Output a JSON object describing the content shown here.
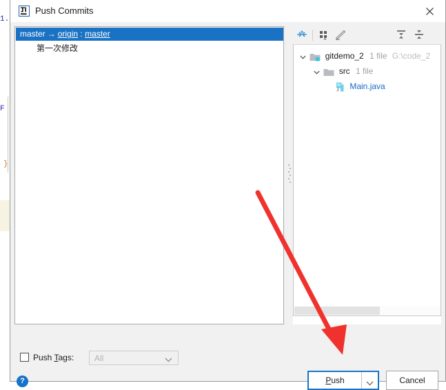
{
  "window": {
    "title": "Push Commits",
    "app_icon": "intellij-idea-icon",
    "close_icon": "close-icon"
  },
  "commits": {
    "group_row": {
      "local_branch": "master",
      "arrow": "→",
      "remote": "origin",
      "separator": ":",
      "remote_branch": "master",
      "selected": true
    },
    "entries": [
      {
        "message": "第一次修改"
      }
    ]
  },
  "files_toolbar": {
    "buttons": [
      {
        "name": "expand-selection-icon",
        "title": ""
      },
      {
        "name": "group-by-icon",
        "title": ""
      },
      {
        "name": "edit-source-icon",
        "title": ""
      },
      {
        "name": "expand-all-icon",
        "title": ""
      },
      {
        "name": "collapse-all-icon",
        "title": ""
      }
    ]
  },
  "file_tree": [
    {
      "name": "gitdemo_2",
      "meta": "1 file",
      "path": "G:\\code_2",
      "icon": "module-folder-icon",
      "expanded": true,
      "depth": 0
    },
    {
      "name": "src",
      "meta": "1 file",
      "path": "",
      "icon": "folder-icon",
      "expanded": true,
      "depth": 1
    },
    {
      "name": "Main.java",
      "meta": "",
      "path": "",
      "icon": "java-class-icon",
      "expanded": null,
      "depth": 2
    }
  ],
  "push_tags": {
    "label_pre": "Push ",
    "label_mnemonic": "T",
    "label_post": "ags:",
    "checked": false,
    "combo_value": "All",
    "combo_enabled": false,
    "chevron_icon": "chevron-down-icon"
  },
  "footer": {
    "help_icon": "help-icon",
    "help_glyph": "?",
    "push_label_pre": "",
    "push_mnemonic": "P",
    "push_label_post": "ush",
    "push_dropdown_icon": "chevron-down-icon",
    "cancel_label": "Cancel"
  },
  "annotation": {
    "type": "red-arrow",
    "color": "#f0322e",
    "points_to": "push-button"
  },
  "colors": {
    "selection_blue": "#1a72c4",
    "link_blue": "#1866c9",
    "accent_blue": "#1673c8",
    "panel_bg": "#f1f1f1"
  }
}
